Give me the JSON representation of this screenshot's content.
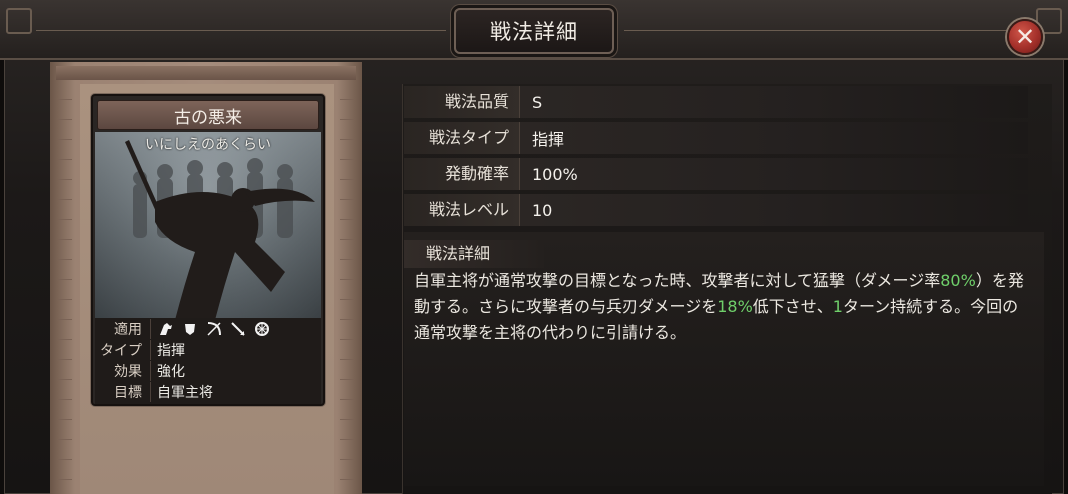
{
  "window": {
    "title": "戦法詳細",
    "close_icon": "close-x-icon"
  },
  "card": {
    "name": "古の悪来",
    "reading": "いにしえのあくらい",
    "info": [
      {
        "label": "適用",
        "value": "",
        "icons": [
          "cavalry-icon",
          "shield-icon",
          "bow-icon",
          "spear-icon",
          "wheel-icon"
        ]
      },
      {
        "label": "タイプ",
        "value": "指揮"
      },
      {
        "label": "効果",
        "value": "強化"
      },
      {
        "label": "目標",
        "value": "自軍主将"
      }
    ]
  },
  "stats": [
    {
      "label": "戦法品質",
      "value": "S"
    },
    {
      "label": "戦法タイプ",
      "value": "指揮"
    },
    {
      "label": "発動確率",
      "value": "100%"
    },
    {
      "label": "戦法レベル",
      "value": "10"
    }
  ],
  "detail": {
    "heading": "戦法詳細",
    "seg1": "自軍主将が通常攻撃の目標となった時、攻撃者に対して猛撃（ダメージ率",
    "hl1": "80%",
    "seg2": "）を発動する。さらに攻撃者の与兵刃ダメージを",
    "hl2": "18%",
    "seg3": "低下させ、",
    "hl3": "1",
    "seg4": "ターン持続する。今回の通常攻撃を主将の代わりに引請ける。",
    "highlight_color": "#6fcf6a"
  }
}
